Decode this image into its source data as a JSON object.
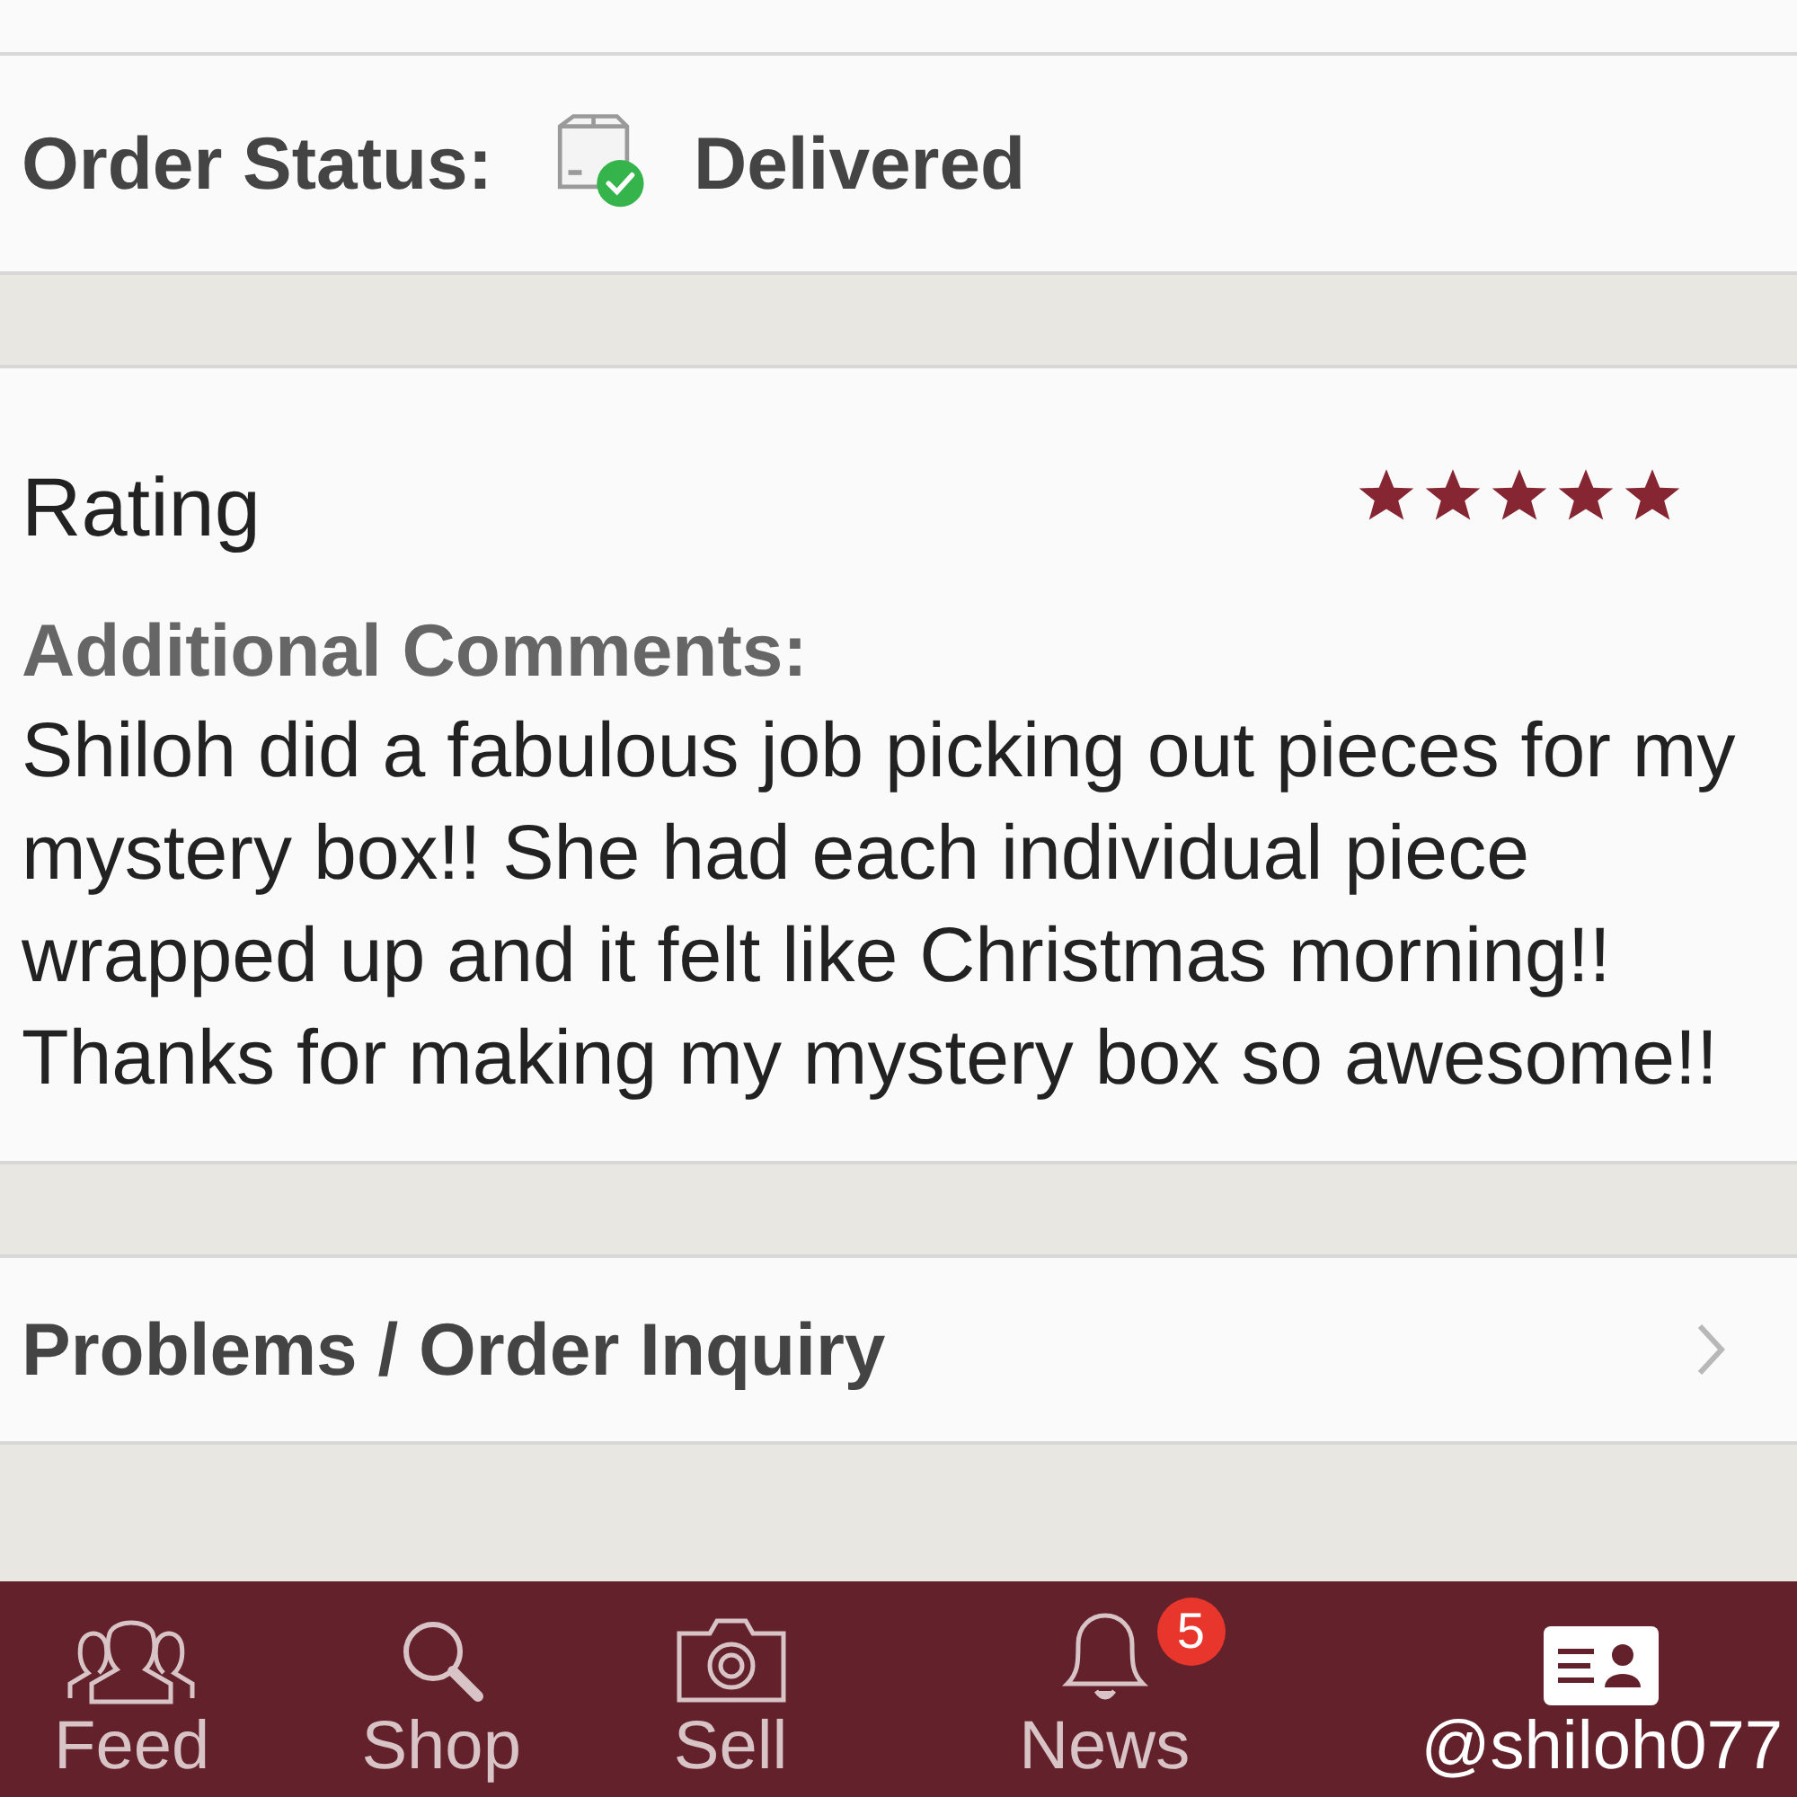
{
  "order_status": {
    "label": "Order Status:",
    "value": "Delivered"
  },
  "rating": {
    "label": "Rating",
    "stars": 5,
    "comments_label": "Additional Comments:",
    "comments": "Shiloh did a fabulous job picking out pieces for my mystery box!! She had each individual piece wrapped up and it felt like Christmas morning!! Thanks for making my mystery box so awesome!!"
  },
  "problems_row": {
    "label": "Problems / Order Inquiry"
  },
  "tab_bar": [
    {
      "kind": "feed",
      "label": "Feed",
      "selected": false
    },
    {
      "kind": "shop",
      "label": "Shop",
      "selected": false
    },
    {
      "kind": "sell",
      "label": "Sell",
      "selected": false
    },
    {
      "kind": "news",
      "label": "News",
      "selected": false,
      "badge": "5"
    },
    {
      "kind": "profile",
      "label": "@shiloh077",
      "selected": true
    }
  ]
}
